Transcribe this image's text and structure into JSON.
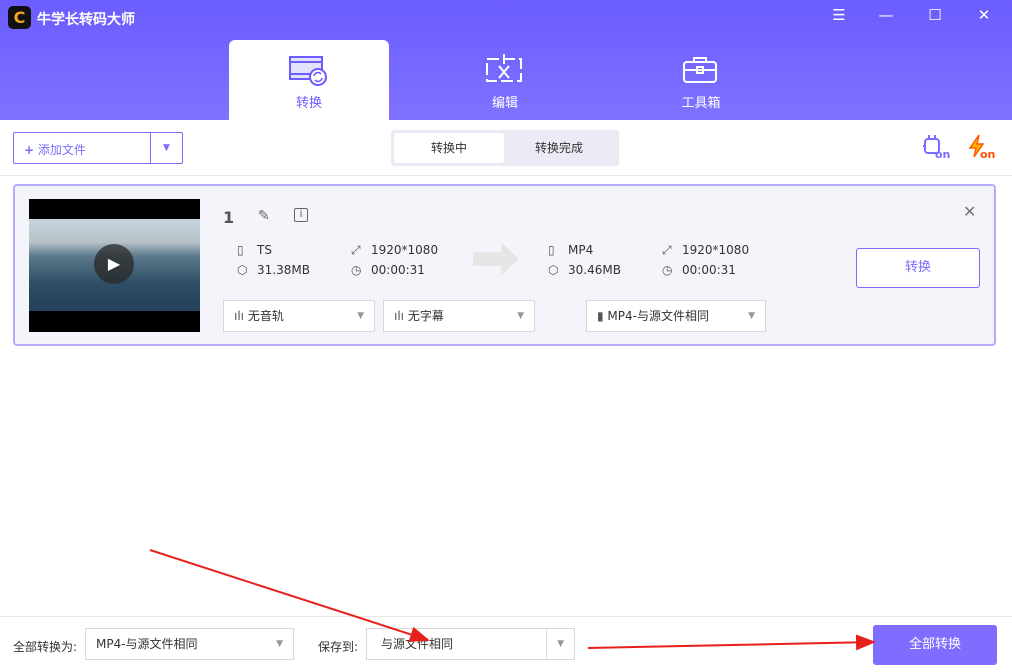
{
  "app": {
    "title": "牛学长转码大师",
    "logo_letter": "C"
  },
  "window": {
    "menu": "☰",
    "minimize": "—",
    "maximize": "☐",
    "close": "✕"
  },
  "tabs": [
    {
      "label": "转换",
      "active": true
    },
    {
      "label": "编辑"
    },
    {
      "label": "工具箱"
    }
  ],
  "toolbar": {
    "add_file": "添加文件",
    "plus": "+",
    "dropdown": "▼",
    "segments": [
      "转换中",
      "转换完成"
    ],
    "gpu_badge": "on",
    "speed_badge": "on"
  },
  "file": {
    "index": "1",
    "source": {
      "format": "TS",
      "size": "31.38MB",
      "resolution": "1920*1080",
      "duration": "00:00:31"
    },
    "target": {
      "format": "MP4",
      "size": "30.46MB",
      "resolution": "1920*1080",
      "duration": "00:00:31"
    },
    "audio": "无音轨",
    "subtitle": "无字幕",
    "output_format": "MP4-与源文件相同",
    "convert_label": "转换",
    "close": "✕"
  },
  "footer": {
    "convert_all_to_label": "全部转换为:",
    "convert_all_to_value": "MP4-与源文件相同",
    "save_to_label": "保存到:",
    "save_to_value": "与源文件相同",
    "convert_all": "全部转换"
  },
  "colors": {
    "accent": "#6b5cff",
    "annotation_arrow": "#e8201c"
  }
}
